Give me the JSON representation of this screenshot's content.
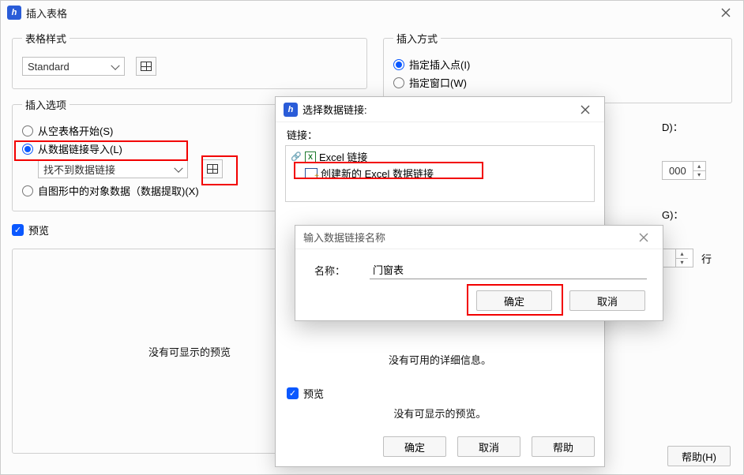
{
  "main": {
    "title": "插入表格",
    "group_style": "表格样式",
    "style_value": "Standard",
    "group_insert_options": "插入选项",
    "opt_empty": "从空表格开始(S)",
    "opt_datalink": "从数据链接导入(L)",
    "datalink_select_value": "找不到数据链接",
    "opt_extract": "自图形中的对象数据（数据提取)(X)",
    "preview_label": "预览",
    "preview_empty": "没有可显示的预览",
    "group_method": "插入方式",
    "method_point": "指定插入点(I)",
    "method_window": "指定窗口(W)",
    "right_suffix_d": "D)：",
    "right_value": "000",
    "right_suffix_g": "G)：",
    "right_unit": "行",
    "help_btn": "帮助(H)"
  },
  "d2": {
    "title": "选择数据链接:",
    "link_label": "链接：",
    "root": "Excel 链接",
    "create_item": "创建新的 Excel 数据链接",
    "details_empty": "没有可用的详细信息。",
    "preview_label": "预览",
    "preview_empty": "没有可显示的预览。",
    "ok": "确定",
    "cancel": "取消",
    "help": "帮助"
  },
  "d3": {
    "title": "输入数据链接名称",
    "name_label": "名称：",
    "name_value": "门窗表",
    "ok": "确定",
    "cancel": "取消"
  }
}
